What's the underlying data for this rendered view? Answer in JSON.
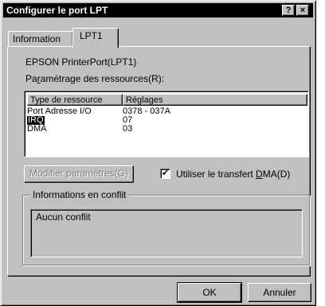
{
  "window": {
    "title": "Configurer le port LPT",
    "help_btn": "?",
    "close_btn": "×"
  },
  "tabs": [
    {
      "label": "Information",
      "active": false
    },
    {
      "label": "LPT1",
      "active": true
    }
  ],
  "device_name": "EPSON PrinterPort(LPT1)",
  "resources_label_pre": "Pa",
  "resources_label_mnemonic": "r",
  "resources_label_post": "amétrage des ressources(R):",
  "resources": {
    "columns": [
      "Type de ressource",
      "Réglages"
    ],
    "rows": [
      {
        "type": "Port Adresse I/O",
        "setting": "0378 - 037A",
        "selected": false
      },
      {
        "type": "IRQ",
        "setting": "07",
        "selected": true
      },
      {
        "type": "DMA",
        "setting": "03",
        "selected": false
      }
    ]
  },
  "modify_button": "Modifier paramètres(G)",
  "dma_checkbox": {
    "label_pre": "Utiliser le transfert ",
    "label_mnemonic": "D",
    "label_post": "MA(D)",
    "checked": true,
    "check_glyph": "✔"
  },
  "conflicts": {
    "group_label": "Informations en conflit",
    "text": "Aucun conflit"
  },
  "footer": {
    "ok_label": "OK",
    "cancel_label": "Annuler"
  }
}
